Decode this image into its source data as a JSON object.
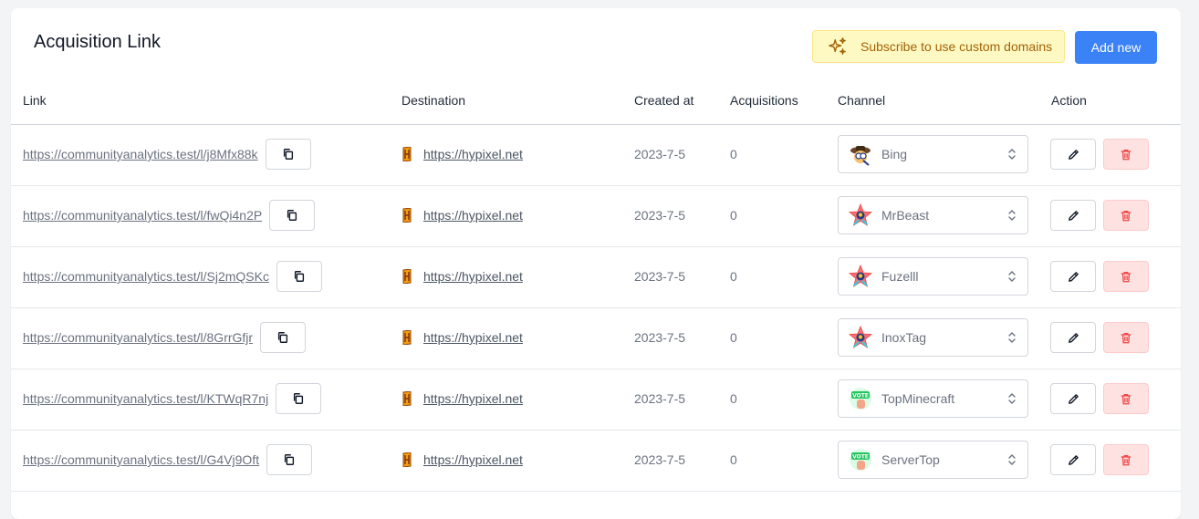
{
  "header": {
    "title": "Acquisition Link",
    "promo_label": "Subscribe to use custom domains",
    "add_label": "Add new"
  },
  "columns": {
    "link": "Link",
    "destination": "Destination",
    "created": "Created at",
    "acquisitions": "Acquisitions",
    "channel": "Channel",
    "action": "Action"
  },
  "rows": [
    {
      "link": "https://communityanalytics.test/l/j8Mfx88k",
      "destination": "https://hypixel.net",
      "created": "2023-7-5",
      "acquisitions": "0",
      "channel": "Bing",
      "channel_icon": "bing-avatar-icon"
    },
    {
      "link": "https://communityanalytics.test/l/fwQi4n2P",
      "destination": "https://hypixel.net",
      "created": "2023-7-5",
      "acquisitions": "0",
      "channel": "MrBeast",
      "channel_icon": "star-avatar-icon"
    },
    {
      "link": "https://communityanalytics.test/l/Sj2mQSKc",
      "destination": "https://hypixel.net",
      "created": "2023-7-5",
      "acquisitions": "0",
      "channel": "Fuzelll",
      "channel_icon": "star-avatar-icon"
    },
    {
      "link": "https://communityanalytics.test/l/8GrrGfjr",
      "destination": "https://hypixel.net",
      "created": "2023-7-5",
      "acquisitions": "0",
      "channel": "InoxTag",
      "channel_icon": "star-avatar-icon"
    },
    {
      "link": "https://communityanalytics.test/l/KTWqR7nj",
      "destination": "https://hypixel.net",
      "created": "2023-7-5",
      "acquisitions": "0",
      "channel": "TopMinecraft",
      "channel_icon": "vote-avatar-icon"
    },
    {
      "link": "https://communityanalytics.test/l/G4Vj9Oft",
      "destination": "https://hypixel.net",
      "created": "2023-7-5",
      "acquisitions": "0",
      "channel": "ServerTop",
      "channel_icon": "vote-avatar-icon"
    }
  ],
  "colors": {
    "primary": "#3b82f6",
    "promo_bg": "#fef9c3",
    "promo_text": "#a16207",
    "delete_bg": "#fee2e2",
    "delete_icon": "#ef4444"
  }
}
